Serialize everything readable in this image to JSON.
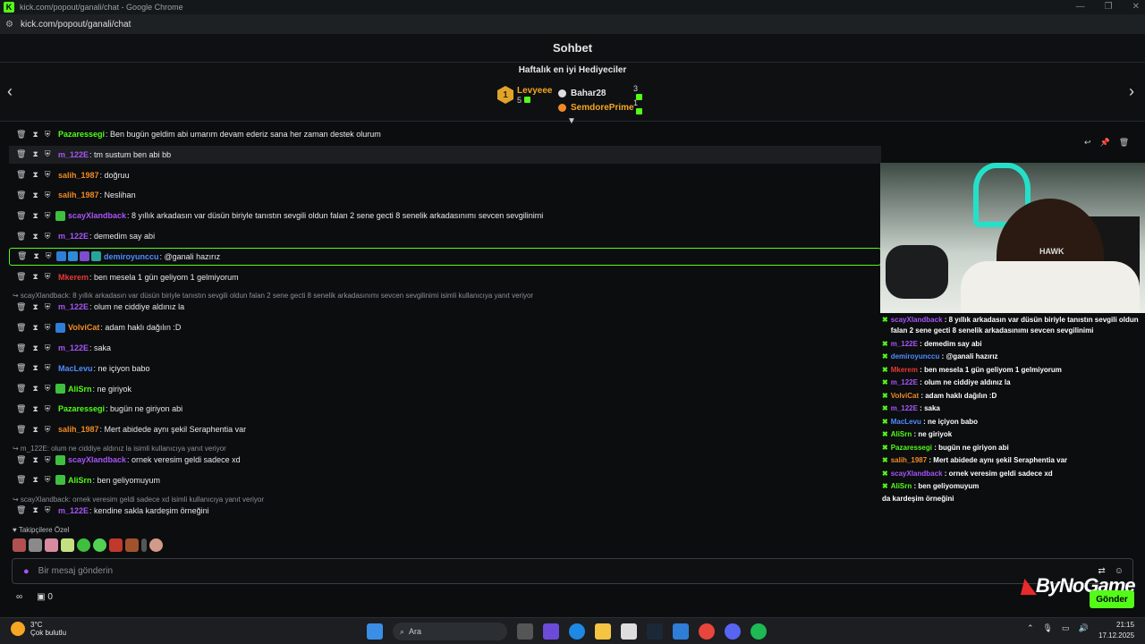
{
  "window": {
    "title": "kick.com/popout/ganali/chat - Google Chrome",
    "url": "kick.com/popout/ganali/chat"
  },
  "header": {
    "title": "Sohbet"
  },
  "gifters": {
    "title": "Haftalık en iyi Hediyeciler",
    "top": {
      "rank": "1",
      "name": "Levyeee",
      "count": "5"
    },
    "others": [
      {
        "name": "Bahar28",
        "count": "3",
        "color": "#e6e6e6"
      },
      {
        "name": "SemdorePrime",
        "count": "1",
        "color": "#f5a623"
      }
    ]
  },
  "messages": [
    {
      "user": "Pazaressegi",
      "color": "#53fc18",
      "text": "Ben bugün geldim abi umarım devam ederiz sana her zaman destek olurum"
    },
    {
      "user": "m_122E",
      "color": "#a855f7",
      "text": "tm sustum ben abi bb"
    },
    {
      "user": "salih_1987",
      "color": "#f08a24",
      "text": "doğruu"
    },
    {
      "user": "salih_1987",
      "color": "#f08a24",
      "text": "Neslihan"
    },
    {
      "user": "scayXlandback",
      "color": "#a855f7",
      "text": "8 yıllık arkadasın var düsün biriyle tanıstın sevgili oldun falan 2 sene gecti 8 senelik arkadasınımı sevcen sevgilinimi"
    },
    {
      "user": "m_122E",
      "color": "#a855f7",
      "text": "demedim say abi"
    },
    {
      "user": "demiroyunccu",
      "color": "#4f8cff",
      "text": "@ganali hazırız"
    },
    {
      "user": "Mkerem",
      "color": "#e53935",
      "text": "ben mesela 1 gün geliyom 1 gelmiyorum"
    },
    {
      "reply": "scayXlandback: 8 yıllık arkadasın var düsün biriyle tanıstın sevgili oldun falan 2 sene gecti 8 senelik arkadasınımı sevcen sevgilinimi isimli kullanıcıya yanıt veriyor",
      "user": "m_122E",
      "color": "#a855f7",
      "text": "olum ne ciddiye aldınız la"
    },
    {
      "user": "VolviCat",
      "color": "#f08a24",
      "text": "adam haklı dağılın :D"
    },
    {
      "user": "m_122E",
      "color": "#a855f7",
      "text": "saka"
    },
    {
      "user": "MacLevu",
      "color": "#4f8cff",
      "text": "ne içiyon babo"
    },
    {
      "user": "AliSrn",
      "color": "#53fc18",
      "text": "ne giriyok"
    },
    {
      "user": "Pazaressegi",
      "color": "#53fc18",
      "text": "bugün ne giriyon abi"
    },
    {
      "user": "salih_1987",
      "color": "#f08a24",
      "text": "Mert abidede aynı şekil Seraphentia var"
    },
    {
      "reply": "m_122E: olum ne ciddiye aldınız la isimli kullanıcıya yanıt veriyor",
      "user": "scayXlandback",
      "color": "#a855f7",
      "text": "ornek veresim geldi sadece xd"
    },
    {
      "user": "AliSrn",
      "color": "#53fc18",
      "text": "ben geliyomuyum"
    },
    {
      "reply": "scayXlandback: ornek veresim geldi sadece xd isimli kullanıcıya yanıt veriyor",
      "user": "m_122E",
      "color": "#a855f7",
      "text": "kendine sakla kardeşim örneğini"
    }
  ],
  "overlay": {
    "lines": [
      {
        "user": "scayXlandback",
        "color": "#a855f7",
        "text": "8 yıllık arkadasın var düsün biriyle tanıstın sevgili oldun falan 2 sene gecti 8 senelik arkadasınımı sevcen sevgilinimi"
      },
      {
        "user": "m_122E",
        "color": "#a855f7",
        "text": "demedim say abi"
      },
      {
        "user": "demiroyunccu",
        "color": "#4f8cff",
        "text": "@ganali hazırız"
      },
      {
        "user": "Mkerem",
        "color": "#e53935",
        "text": "ben mesela 1 gün geliyom 1 gelmiyorum"
      },
      {
        "user": "m_122E",
        "color": "#a855f7",
        "text": "olum ne ciddiye aldınız la"
      },
      {
        "user": "VolviCat",
        "color": "#f08a24",
        "text": "adam haklı dağılın :D"
      },
      {
        "user": "m_122E",
        "color": "#a855f7",
        "text": "saka"
      },
      {
        "user": "MacLevu",
        "color": "#4f8cff",
        "text": "ne içiyon babo"
      },
      {
        "user": "AliSrn",
        "color": "#53fc18",
        "text": "ne giriyok"
      },
      {
        "user": "Pazaressegi",
        "color": "#53fc18",
        "text": "bugün ne giriyon abi"
      },
      {
        "user": "salih_1987",
        "color": "#f08a24",
        "text": "Mert abidede aynı şekil Seraphentia var"
      },
      {
        "user": "scayXlandback",
        "color": "#a855f7",
        "text": "ornek veresim geldi sadece xd"
      },
      {
        "user": "AliSrn",
        "color": "#53fc18",
        "text": "ben geliyomuyum"
      }
    ],
    "tail": "da kardeşim örneğini",
    "camera_text": "HAWK"
  },
  "followers": {
    "label": "Takipçilere Özel"
  },
  "input": {
    "placeholder": "Bir mesaj gönderin",
    "send_label": "Gönder"
  },
  "bottom": {
    "followers_count": "0"
  },
  "logo": {
    "text": "ByNoGame"
  },
  "taskbar": {
    "temp": "3°C",
    "weather": "Çok bulutlu",
    "search": "Ara",
    "time": "21:15",
    "date": "17.12.2025"
  }
}
